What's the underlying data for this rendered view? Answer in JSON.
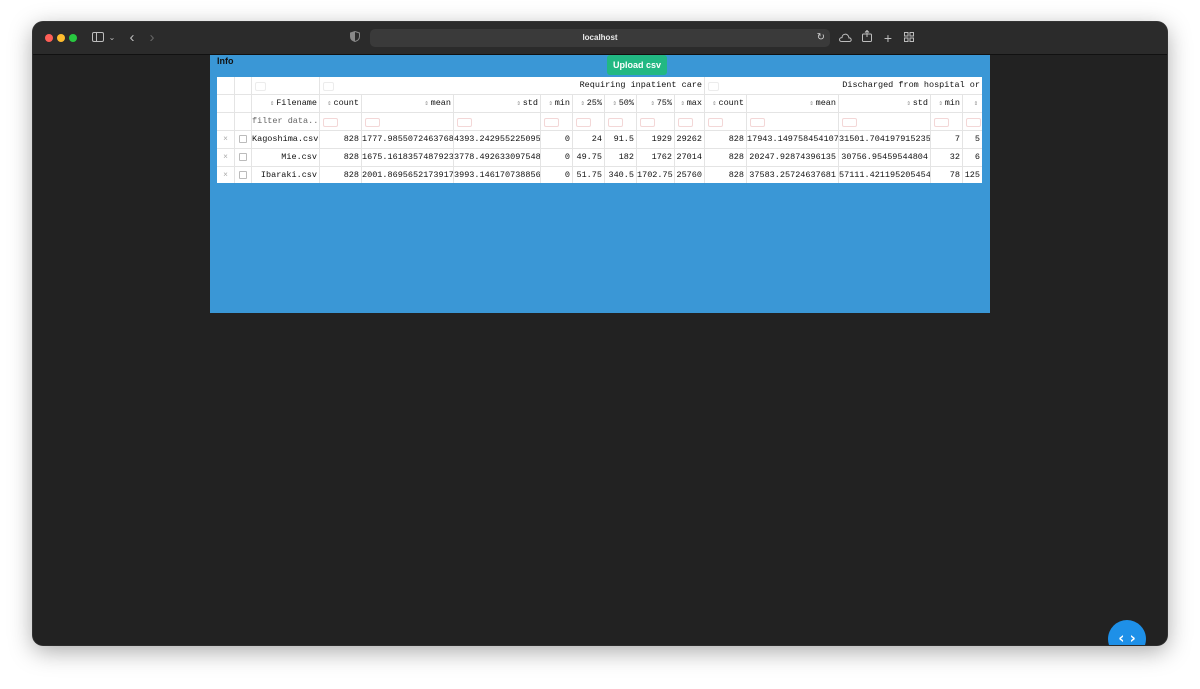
{
  "browser": {
    "url": "localhost"
  },
  "app": {
    "panel_title": "Info",
    "upload_button": "Upload csv"
  },
  "table": {
    "group_headers": [
      "Requiring inpatient care",
      "Discharged from hospital or"
    ],
    "filename_header": "Filename",
    "columns": [
      "count",
      "mean",
      "std",
      "min",
      "25%",
      "50%",
      "75%",
      "max",
      "count",
      "mean",
      "std",
      "min"
    ],
    "filter_placeholder": "filter data...",
    "rows": [
      {
        "filename": "Kagoshima.csv",
        "cells": [
          "828",
          "1777.9855072463768",
          "4393.242955225095",
          "0",
          "24",
          "91.5",
          "1929",
          "29262",
          "828",
          "17943.149758454107",
          "31501.704197915235",
          "7",
          "5"
        ]
      },
      {
        "filename": "Mie.csv",
        "cells": [
          "828",
          "1675.1618357487923",
          "3778.492633097548",
          "0",
          "49.75",
          "182",
          "1762",
          "27014",
          "828",
          "20247.92874396135",
          "30756.95459544804",
          "32",
          "6"
        ]
      },
      {
        "filename": "Ibaraki.csv",
        "cells": [
          "828",
          "2001.8695652173917",
          "3993.146170738856",
          "0",
          "51.75",
          "340.5",
          "1702.75",
          "25760",
          "828",
          "37583.25724637681",
          "57111.421195205454",
          "78",
          "125"
        ]
      }
    ]
  },
  "colors": {
    "panel_bg": "#3a97d6",
    "upload_button_bg": "#22b883",
    "fab_bg": "#1e90e8",
    "window_bg": "#222222"
  },
  "icons": {
    "delete": "×",
    "sort": "⇕",
    "fab": "‹ ›"
  }
}
